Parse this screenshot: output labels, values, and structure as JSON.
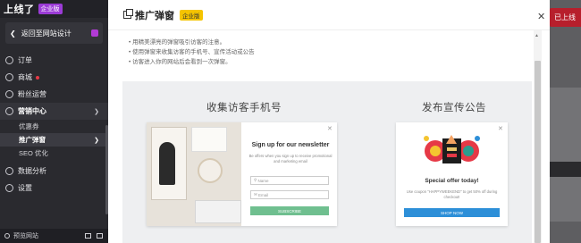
{
  "sidebar": {
    "logo": "上线了",
    "logo_badge": "企业版",
    "back_label": "返回至网站设计",
    "items": [
      {
        "label": "订单",
        "icon": "order-icon"
      },
      {
        "label": "商城",
        "icon": "shop-icon"
      },
      {
        "label": "粉丝运营",
        "icon": "fans-icon"
      },
      {
        "label": "营销中心",
        "icon": "marketing-icon"
      },
      {
        "label": "数据分析",
        "icon": "analytics-icon"
      },
      {
        "label": "设置",
        "icon": "gear-icon"
      }
    ],
    "submenu": [
      "优惠券",
      "推广弹窗",
      "SEO 优化"
    ],
    "bottom_label": "预览网站"
  },
  "header_right": {
    "button_label": "已上线"
  },
  "modal": {
    "title": "推广弹窗",
    "tag": "企业版",
    "bullets": [
      "用精美漂亮的弹窗吸引访客的注意。",
      "使用弹窗来收集访客的手机号、宣传活动或公告",
      "访客进入你的网站后会看到一次弹窗。"
    ],
    "col1_title": "收集访客手机号",
    "col2_title": "发布宣传公告",
    "card1": {
      "heading": "Sign up for our newsletter",
      "desc": "Be offers when you sign up to receive promotional and marketing email",
      "name_placeholder": "Name",
      "email_placeholder": "Email",
      "button": "SUBSCRIBE"
    },
    "card2": {
      "heading": "Special offer today!",
      "desc": "Use coupon \"HAPPYWEEKEND\" to get 50% off during checkout!",
      "button": "SHOP NOW"
    }
  },
  "colors": {
    "accent_purple": "#9b3bd6",
    "tag_yellow": "#f5c400",
    "subscribe_green": "#6fbf8f",
    "shop_blue": "#2d8fd8",
    "red_button": "#b71f2c"
  }
}
